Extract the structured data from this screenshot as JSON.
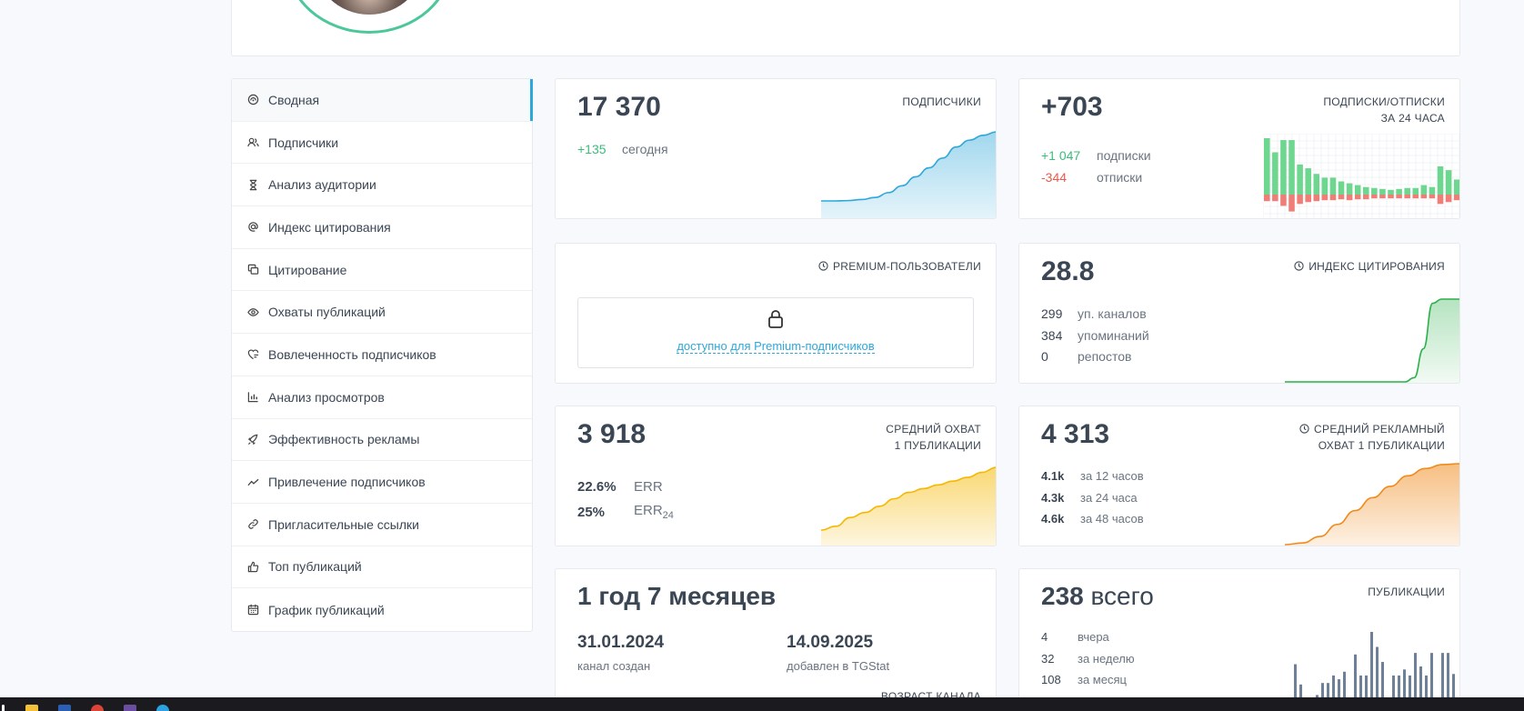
{
  "sidebar": {
    "items": [
      {
        "label": "Сводная",
        "icon": "dashboard-icon"
      },
      {
        "label": "Подписчики",
        "icon": "users-icon"
      },
      {
        "label": "Анализ аудитории",
        "icon": "hourglass-icon"
      },
      {
        "label": "Индекс цитирования",
        "icon": "at-icon"
      },
      {
        "label": "Цитирование",
        "icon": "quote-icon"
      },
      {
        "label": "Охваты публикаций",
        "icon": "eye-icon"
      },
      {
        "label": "Вовлеченность подписчиков",
        "icon": "engagement-icon"
      },
      {
        "label": "Анализ просмотров",
        "icon": "bar-chart-icon"
      },
      {
        "label": "Эффективность рекламы",
        "icon": "rocket-icon"
      },
      {
        "label": "Привлечение подписчиков",
        "icon": "trend-icon"
      },
      {
        "label": "Пригласительные ссылки",
        "icon": "link-icon"
      },
      {
        "label": "Топ публикаций",
        "icon": "thumbs-up-icon"
      },
      {
        "label": "График публикаций",
        "icon": "calendar-icon"
      }
    ]
  },
  "cards": {
    "subscribers": {
      "value": "17 370",
      "label": "ПОДПИСЧИКИ",
      "today_value": "+135",
      "today_label": "сегодня"
    },
    "subs_unsubs": {
      "value": "+703",
      "label": "ПОДПИСКИ/ОТПИСКИ\nЗА 24 ЧАСА",
      "subs_value": "+1 047",
      "subs_label": "подписки",
      "unsubs_value": "-344",
      "unsubs_label": "отписки"
    },
    "premium": {
      "label": "PREMIUM-ПОЛЬЗОВАТЕЛИ",
      "link": "доступно для Premium-подписчиков"
    },
    "citation": {
      "value": "28.8",
      "label": "ИНДЕКС ЦИТИРОВАНИЯ",
      "rows": [
        {
          "v": "299",
          "t": "уп. каналов"
        },
        {
          "v": "384",
          "t": "упоминаний"
        },
        {
          "v": "0",
          "t": "репостов"
        }
      ]
    },
    "avg_reach": {
      "value": "3 918",
      "label": "СРЕДНИЙ ОХВАТ\n1 ПУБЛИКАЦИИ",
      "err_value": "22.6%",
      "err_label": "ERR",
      "err24_value": "25%",
      "err24_label": "ERR",
      "err24_sub": "24"
    },
    "ad_reach": {
      "value": "4 313",
      "label": "СРЕДНИЙ РЕКЛАМНЫЙ\nОХВАТ 1 ПУБЛИКАЦИИ",
      "rows": [
        {
          "v": "4.1k",
          "t": "за 12 часов"
        },
        {
          "v": "4.3k",
          "t": "за 24 часа"
        },
        {
          "v": "4.6k",
          "t": "за 48 часов"
        }
      ]
    },
    "age": {
      "value": "1 год 7 месяцев",
      "created_date": "31.01.2024",
      "created_label": "канал создан",
      "added_date": "14.09.2025",
      "added_label": "добавлен в TGStat",
      "label": "ВОЗРАСТ КАНАЛА"
    },
    "posts": {
      "value_num": "238",
      "value_word": "всего",
      "label": "ПУБЛИКАЦИИ",
      "rows": [
        {
          "v": "4",
          "t": "вчера"
        },
        {
          "v": "32",
          "t": "за неделю"
        },
        {
          "v": "108",
          "t": "за месяц"
        }
      ]
    }
  },
  "colors": {
    "accent": "#2ea7d9",
    "green": "#3dbb7a",
    "red": "#e8594f",
    "yellow": "#f5b800",
    "orange": "#f08a1c",
    "slate": "#6e7f99"
  },
  "chart_data": [
    {
      "type": "area",
      "name": "subscribers-trend",
      "values": [
        0,
        0,
        0.5,
        2,
        5,
        12,
        22,
        35,
        48,
        62,
        78,
        88,
        95,
        100
      ]
    },
    {
      "type": "bar",
      "name": "subs-unsubs",
      "subs": [
        60,
        45,
        58,
        58,
        32,
        28,
        22,
        18,
        18,
        14,
        12,
        10,
        8,
        7,
        6,
        5,
        6,
        7,
        7,
        10,
        8,
        30,
        26,
        16
      ],
      "unsubs": [
        7,
        7,
        12,
        18,
        10,
        8,
        7,
        6,
        6,
        5,
        6,
        5,
        5,
        4,
        4,
        4,
        4,
        4,
        4,
        4,
        4,
        10,
        8,
        6
      ]
    },
    {
      "type": "area",
      "name": "citation-trend",
      "values": [
        0,
        0,
        0,
        0,
        0,
        0,
        0,
        0,
        0,
        0,
        0,
        0,
        0,
        0,
        5,
        40,
        95,
        100,
        100,
        100
      ]
    },
    {
      "type": "area",
      "name": "avg-reach-trend",
      "values": [
        0,
        6,
        20,
        28,
        38,
        50,
        60,
        66,
        72,
        78,
        84,
        92,
        100
      ]
    },
    {
      "type": "area",
      "name": "ad-reach-trend",
      "values": [
        0,
        2,
        10,
        25,
        42,
        58,
        72,
        85,
        94,
        99,
        100
      ]
    },
    {
      "type": "bar",
      "name": "posts-per-day",
      "values": [
        55,
        28,
        0,
        0,
        14,
        30,
        30,
        40,
        35,
        45,
        0,
        68,
        40,
        40,
        98,
        78,
        58,
        0,
        40,
        40,
        48,
        40,
        70,
        52,
        40,
        70,
        0,
        70,
        70,
        42
      ]
    }
  ]
}
